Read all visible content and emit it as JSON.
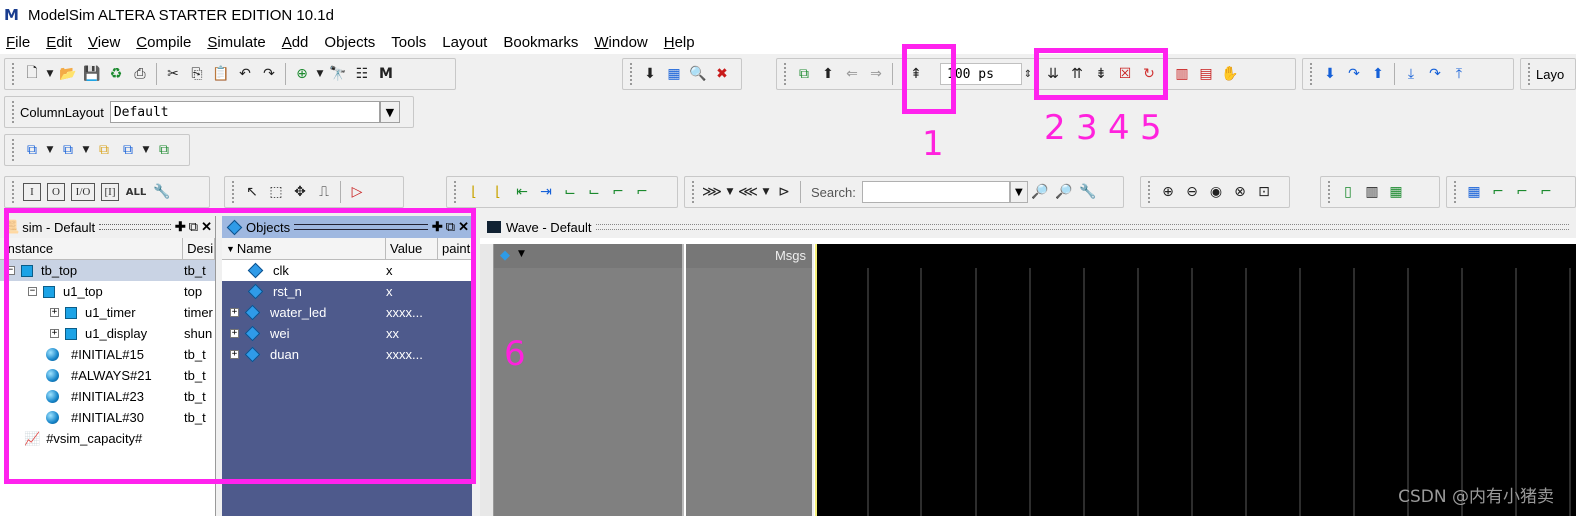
{
  "window": {
    "title": "ModelSim ALTERA STARTER EDITION 10.1d",
    "logo": "M"
  },
  "menu": {
    "items": [
      {
        "key": "F",
        "rest": "ile"
      },
      {
        "key": "E",
        "rest": "dit"
      },
      {
        "key": "V",
        "rest": "iew"
      },
      {
        "key": "C",
        "rest": "ompile"
      },
      {
        "key": "S",
        "rest": "imulate"
      },
      {
        "key": "A",
        "rest": "dd",
        "pre": ""
      },
      {
        "key": "",
        "rest": "Objects"
      },
      {
        "key": "",
        "rest": "Tools"
      },
      {
        "key": "",
        "rest": "Layout"
      },
      {
        "key": "",
        "rest": "Bookmarks"
      },
      {
        "key": "W",
        "rest": "indow"
      },
      {
        "key": "H",
        "rest": "elp"
      }
    ]
  },
  "toolbar": {
    "run_length": "100 ps",
    "column_layout_label": "ColumnLayout",
    "column_layout_value": "Default",
    "search_label": "Search:",
    "search_value": "",
    "layout_label": "Layo",
    "filter_buttons": [
      "I",
      "O",
      "I/O",
      "[I]",
      "ALL"
    ]
  },
  "sim_panel": {
    "title": "sim - Default",
    "columns": [
      "Instance",
      "Desi"
    ],
    "rows": [
      {
        "name": "tb_top",
        "design": "tb_t"
      },
      {
        "name": "u1_top",
        "design": "top"
      },
      {
        "name": "u1_timer",
        "design": "timer"
      },
      {
        "name": "u1_display",
        "design": "shun"
      },
      {
        "name": "#INITIAL#15",
        "design": "tb_t"
      },
      {
        "name": "#ALWAYS#21",
        "design": "tb_t"
      },
      {
        "name": "#INITIAL#23",
        "design": "tb_t"
      },
      {
        "name": "#INITIAL#30",
        "design": "tb_t"
      },
      {
        "name": "#vsim_capacity#",
        "design": ""
      }
    ]
  },
  "objects_panel": {
    "title": "Objects",
    "columns": [
      "Name",
      "Value",
      "paint"
    ],
    "rows": [
      {
        "name": "clk",
        "value": "x"
      },
      {
        "name": "rst_n",
        "value": "x"
      },
      {
        "name": "water_led",
        "value": "xxxx..."
      },
      {
        "name": "wei",
        "value": "xx"
      },
      {
        "name": "duan",
        "value": "xxxx..."
      }
    ]
  },
  "wave_panel": {
    "title": "Wave - Default",
    "msgs_label": "Msgs"
  },
  "annotations": {
    "a1": "1",
    "a2": "2",
    "a3": "3",
    "a4": "4",
    "a5": "5",
    "a6": "6"
  },
  "watermark": "CSDN @内有小猪卖",
  "colors": {
    "annotation": "#ff22ee",
    "objects_bg": "#4e5a8c",
    "wave_bg": "#000000",
    "cursor": "#f5f07a"
  }
}
